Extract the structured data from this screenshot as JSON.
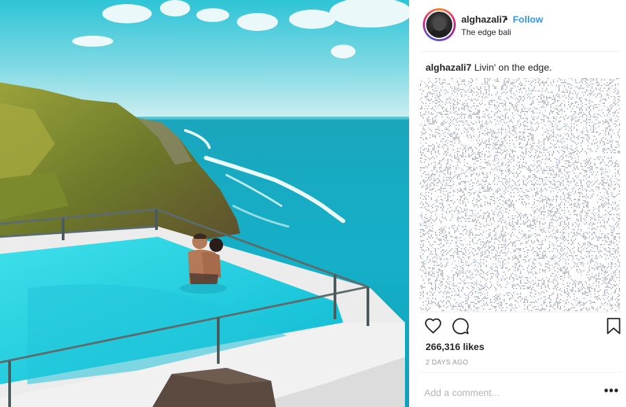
{
  "post": {
    "photo_alt": "",
    "author": {
      "username": "alghazali7",
      "follow_label": "Follow",
      "separator": "•",
      "location": "The edge bali"
    },
    "caption": {
      "username": "alghazali7",
      "text": "Livin' on the edge."
    },
    "actions": {
      "like_icon": "heart-icon",
      "comment_icon": "comment-icon",
      "save_icon": "bookmark-icon"
    },
    "likes_text": "266,316 likes",
    "timestamp": "2 DAYS AGO",
    "add_comment_placeholder": "Add a comment...",
    "more_label": "•••",
    "colors": {
      "link_blue": "#3897f0",
      "text": "#262626",
      "muted": "#999999",
      "divider": "#efefef"
    }
  }
}
